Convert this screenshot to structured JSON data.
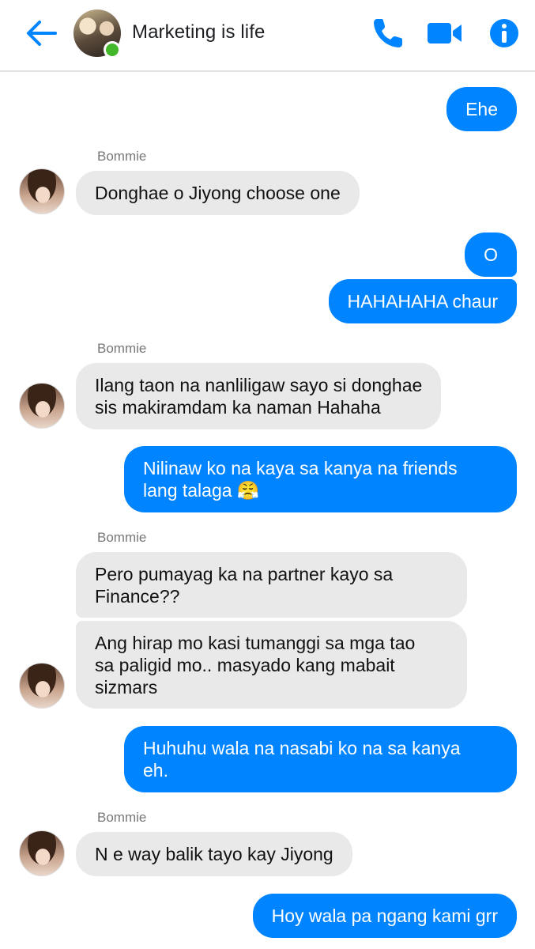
{
  "header": {
    "title": "Marketing is life",
    "accent": "#0084ff",
    "icons": [
      "back-arrow-icon",
      "phone-icon",
      "video-camera-icon",
      "info-icon"
    ]
  },
  "colors": {
    "outgoing": "#0084ff",
    "incoming": "#e9e9e9",
    "online": "#42b72a"
  },
  "messages": {
    "m1": "Ehe",
    "s1": "Bommie",
    "m2": "Donghae o Jiyong choose one",
    "m3": "O",
    "m4": "HAHAHAHA chaur",
    "s2": "Bommie",
    "m5": "Ilang taon na nanliligaw sayo si donghae\nsis makiramdam ka naman Hahaha",
    "m6": "Nilinaw ko na kaya sa kanya na friends\nlang talaga 😤",
    "s3": "Bommie",
    "m7": "Pero pumayag ka na partner kayo sa\nFinance??",
    "m8": "Ang hirap mo kasi tumanggi sa mga tao\nsa paligid mo.. masyado kang mabait\nsizmars",
    "m9": "Huhuhu wala na nasabi ko na sa kanya\neh.",
    "s4": "Bommie",
    "m10": "N e way balik tayo kay Jiyong",
    "m11": "Hoy wala pa ngang kami grr"
  }
}
